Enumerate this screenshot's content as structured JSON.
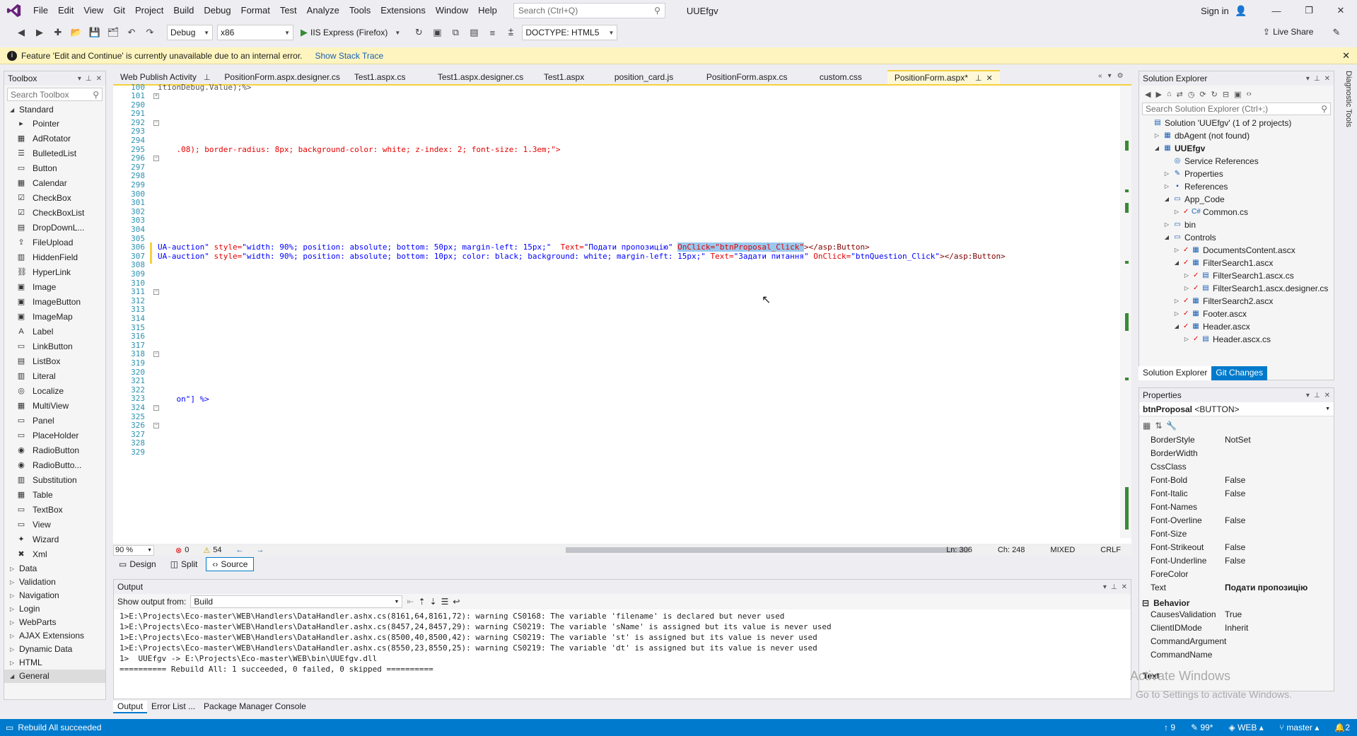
{
  "menubar": {
    "items": [
      "File",
      "Edit",
      "View",
      "Git",
      "Project",
      "Build",
      "Debug",
      "Format",
      "Test",
      "Analyze",
      "Tools",
      "Extensions",
      "Window",
      "Help"
    ],
    "search_placeholder": "Search (Ctrl+Q)",
    "solution_name": "UUEfgv",
    "sign_in": "Sign in"
  },
  "toolbar": {
    "configuration": "Debug",
    "platform": "x86",
    "run_label": "IIS Express (Firefox)",
    "doctype": "DOCTYPE: HTML5",
    "live_share": "Live Share"
  },
  "infobar": {
    "message": "Feature 'Edit and Continue' is currently unavailable due to an internal error.",
    "link": "Show Stack Trace"
  },
  "toolbox": {
    "title": "Toolbox",
    "search_placeholder": "Search Toolbox",
    "standard_group": "Standard",
    "items": [
      {
        "label": "Pointer",
        "icon": "▸"
      },
      {
        "label": "AdRotator",
        "icon": "▦"
      },
      {
        "label": "BulletedList",
        "icon": "☰"
      },
      {
        "label": "Button",
        "icon": "▭"
      },
      {
        "label": "Calendar",
        "icon": "▦"
      },
      {
        "label": "CheckBox",
        "icon": "☑"
      },
      {
        "label": "CheckBoxList",
        "icon": "☑"
      },
      {
        "label": "DropDownL...",
        "icon": "▤"
      },
      {
        "label": "FileUpload",
        "icon": "⇪"
      },
      {
        "label": "HiddenField",
        "icon": "▥"
      },
      {
        "label": "HyperLink",
        "icon": "⛓"
      },
      {
        "label": "Image",
        "icon": "▣"
      },
      {
        "label": "ImageButton",
        "icon": "▣"
      },
      {
        "label": "ImageMap",
        "icon": "▣"
      },
      {
        "label": "Label",
        "icon": "A"
      },
      {
        "label": "LinkButton",
        "icon": "▭"
      },
      {
        "label": "ListBox",
        "icon": "▤"
      },
      {
        "label": "Literal",
        "icon": "▥"
      },
      {
        "label": "Localize",
        "icon": "◎"
      },
      {
        "label": "MultiView",
        "icon": "▦"
      },
      {
        "label": "Panel",
        "icon": "▭"
      },
      {
        "label": "PlaceHolder",
        "icon": "▭"
      },
      {
        "label": "RadioButton",
        "icon": "◉"
      },
      {
        "label": "RadioButto...",
        "icon": "◉"
      },
      {
        "label": "Substitution",
        "icon": "▥"
      },
      {
        "label": "Table",
        "icon": "▦"
      },
      {
        "label": "TextBox",
        "icon": "▭"
      },
      {
        "label": "View",
        "icon": "▭"
      },
      {
        "label": "Wizard",
        "icon": "✦"
      },
      {
        "label": "Xml",
        "icon": "✖"
      }
    ],
    "groups": [
      "Data",
      "Validation",
      "Navigation",
      "Login",
      "WebParts",
      "AJAX Extensions",
      "Dynamic Data",
      "HTML",
      "General"
    ]
  },
  "doc_tabs": [
    {
      "label": "Web Publish Activity"
    },
    {
      "label": "PositionForm.aspx.designer.cs"
    },
    {
      "label": "Test1.aspx.cs"
    },
    {
      "label": "Test1.aspx.designer.cs"
    },
    {
      "label": "Test1.aspx"
    },
    {
      "label": "position_card.js"
    },
    {
      "label": "PositionForm.aspx.cs"
    },
    {
      "label": "custom.css"
    },
    {
      "label": "PositionForm.aspx*"
    }
  ],
  "editor": {
    "top_fragment": "itionDebug.Value);%>",
    "line_numbers": [
      "100",
      "101",
      "290",
      "291",
      "292",
      "293",
      "294",
      "295",
      "296",
      "297",
      "298",
      "299",
      "300",
      "301",
      "302",
      "303",
      "304",
      "305",
      "306",
      "307",
      "308",
      "309",
      "310",
      "311",
      "312",
      "313",
      "314",
      "315",
      "316",
      "317",
      "318",
      "319",
      "320",
      "321",
      "322",
      "323",
      "324",
      "325",
      "326",
      "327",
      "328",
      "329"
    ],
    "line_294": ".08); border-radius: 8px; background-color: white; z-index: 2; font-size: 1.3em;\">",
    "line_306_a": "UA-auction\" ",
    "line_306_b": "style=",
    "line_306_c": "\"width: 90%; position: absolute; bottom: 50px; margin-left: 15px;\"  ",
    "line_306_d": "Text=",
    "line_306_e": "\"Подати пропозицію\" ",
    "line_306_sel": "OnClick=\"btnProposal_Click\"",
    "line_306_f": "></asp:Button>",
    "line_307_a": "UA-auction\" ",
    "line_307_b": "style=",
    "line_307_c": "\"width: 90%; position: absolute; bottom: 10px; color: black; background: white; margin-left: 15px;\" ",
    "line_307_d": "Text=",
    "line_307_e": "\"Задати питання\" ",
    "line_307_f": "OnClick=",
    "line_307_g": "\"btnQuestion_Click\"",
    "line_307_h": "></asp:Button>",
    "line_322": "on\"] %>"
  },
  "editor_status": {
    "zoom": "90 %",
    "errors": "0",
    "warnings": "54",
    "ln": "Ln: 306",
    "ch": "Ch: 248",
    "mode": "MIXED",
    "eol": "CRLF"
  },
  "view_tabs": [
    "Design",
    "Split",
    "Source"
  ],
  "output": {
    "title": "Output",
    "show_from_label": "Show output from:",
    "source": "Build",
    "lines": [
      "1>E:\\Projects\\Eco-master\\WEB\\Handlers\\DataHandler.ashx.cs(8161,64,8161,72): warning CS0168: The variable 'filename' is declared but never used",
      "1>E:\\Projects\\Eco-master\\WEB\\Handlers\\DataHandler.ashx.cs(8457,24,8457,29): warning CS0219: The variable 'sName' is assigned but its value is never used",
      "1>E:\\Projects\\Eco-master\\WEB\\Handlers\\DataHandler.ashx.cs(8500,40,8500,42): warning CS0219: The variable 'st' is assigned but its value is never used",
      "1>E:\\Projects\\Eco-master\\WEB\\Handlers\\DataHandler.ashx.cs(8550,23,8550,25): warning CS0219: The variable 'dt' is assigned but its value is never used",
      "1>  UUEfgv -> E:\\Projects\\Eco-master\\WEB\\bin\\UUEfgv.dll",
      "========== Rebuild All: 1 succeeded, 0 failed, 0 skipped =========="
    ]
  },
  "bottom_tabs": [
    "Output",
    "Error List ...",
    "Package Manager Console"
  ],
  "solution_explorer": {
    "title": "Solution Explorer",
    "search_placeholder": "Search Solution Explorer (Ctrl+;)",
    "tree": [
      {
        "label": "Solution 'UUEfgv' (1 of 2 projects)",
        "indent": 0,
        "tri": "",
        "ico": "▤"
      },
      {
        "label": "dbAgent (not found)",
        "indent": 1,
        "tri": "▷",
        "ico": "▦"
      },
      {
        "label": "UUEfgv",
        "indent": 1,
        "tri": "◢",
        "ico": "▦",
        "bold": true
      },
      {
        "label": "Service References",
        "indent": 2,
        "tri": "",
        "ico": "◎"
      },
      {
        "label": "Properties",
        "indent": 2,
        "tri": "▷",
        "ico": "✎"
      },
      {
        "label": "References",
        "indent": 2,
        "tri": "▷",
        "ico": "▪"
      },
      {
        "label": "App_Code",
        "indent": 2,
        "tri": "◢",
        "ico": "▭"
      },
      {
        "label": "Common.cs",
        "indent": 3,
        "tri": "▷",
        "ico": "C#"
      },
      {
        "label": "bin",
        "indent": 2,
        "tri": "▷",
        "ico": "▭"
      },
      {
        "label": "Controls",
        "indent": 2,
        "tri": "◢",
        "ico": "▭"
      },
      {
        "label": "DocumentsContent.ascx",
        "indent": 3,
        "tri": "▷",
        "ico": "▦"
      },
      {
        "label": "FilterSearch1.ascx",
        "indent": 3,
        "tri": "◢",
        "ico": "▦"
      },
      {
        "label": "FilterSearch1.ascx.cs",
        "indent": 4,
        "tri": "▷",
        "ico": "▤"
      },
      {
        "label": "FilterSearch1.ascx.designer.cs",
        "indent": 4,
        "tri": "▷",
        "ico": "▤"
      },
      {
        "label": "FilterSearch2.ascx",
        "indent": 3,
        "tri": "▷",
        "ico": "▦"
      },
      {
        "label": "Footer.ascx",
        "indent": 3,
        "tri": "▷",
        "ico": "▦"
      },
      {
        "label": "Header.ascx",
        "indent": 3,
        "tri": "◢",
        "ico": "▦"
      },
      {
        "label": "Header.ascx.cs",
        "indent": 4,
        "tri": "▷",
        "ico": "▤"
      }
    ],
    "tabs": [
      "Solution Explorer",
      "Git Changes"
    ]
  },
  "properties": {
    "title": "Properties",
    "object": "btnProposal",
    "object_type": "<BUTTON>",
    "rows": [
      {
        "name": "BorderStyle",
        "value": "NotSet"
      },
      {
        "name": "BorderWidth",
        "value": ""
      },
      {
        "name": "CssClass",
        "value": ""
      },
      {
        "name": "Font-Bold",
        "value": "False"
      },
      {
        "name": "Font-Italic",
        "value": "False"
      },
      {
        "name": "Font-Names",
        "value": ""
      },
      {
        "name": "Font-Overline",
        "value": "False"
      },
      {
        "name": "Font-Size",
        "value": ""
      },
      {
        "name": "Font-Strikeout",
        "value": "False"
      },
      {
        "name": "Font-Underline",
        "value": "False"
      },
      {
        "name": "ForeColor",
        "value": ""
      },
      {
        "name": "Text",
        "value": "Подати пропозицію",
        "bold": true
      }
    ],
    "category": "Behavior",
    "rows2": [
      {
        "name": "CausesValidation",
        "value": "True"
      },
      {
        "name": "ClientIDMode",
        "value": "Inherit"
      },
      {
        "name": "CommandArgument",
        "value": ""
      },
      {
        "name": "CommandName",
        "value": ""
      }
    ],
    "description_title": "Text"
  },
  "watermark": {
    "title": "Activate Windows",
    "subtitle": "Go to Settings to activate Windows."
  },
  "statusbar": {
    "message": "Rebuild All succeeded",
    "up_count": "9",
    "pen_count": "99*",
    "branch_repo": "WEB",
    "branch": "master",
    "notifications": "2"
  },
  "side_strip": "Diagnostic Tools",
  "colors": {
    "accent": "#007acc",
    "selection": "#99c9ef",
    "active_tab": "#f6d03e",
    "infobar": "#fdf4bf",
    "attr": "#e50000",
    "value": "#0000ff",
    "line_number": "#2b91af"
  }
}
